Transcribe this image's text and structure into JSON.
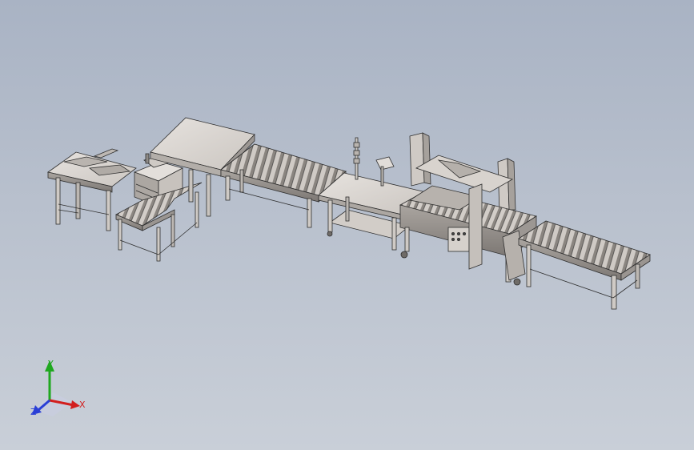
{
  "viewport": {
    "background_top": "#a9b3c4",
    "background_bottom": "#c9cfd8"
  },
  "model": {
    "stroke_color": "#2e2e2e",
    "light_face": "#dcd9d6",
    "mid_face": "#c6c2be",
    "dark_face": "#8f8b87"
  },
  "triad": {
    "x_label": "X",
    "y_label": "Y",
    "z_label": "Z",
    "x_color": "#d21e1e",
    "y_color": "#1fa81f",
    "z_color": "#2a3fd6"
  }
}
